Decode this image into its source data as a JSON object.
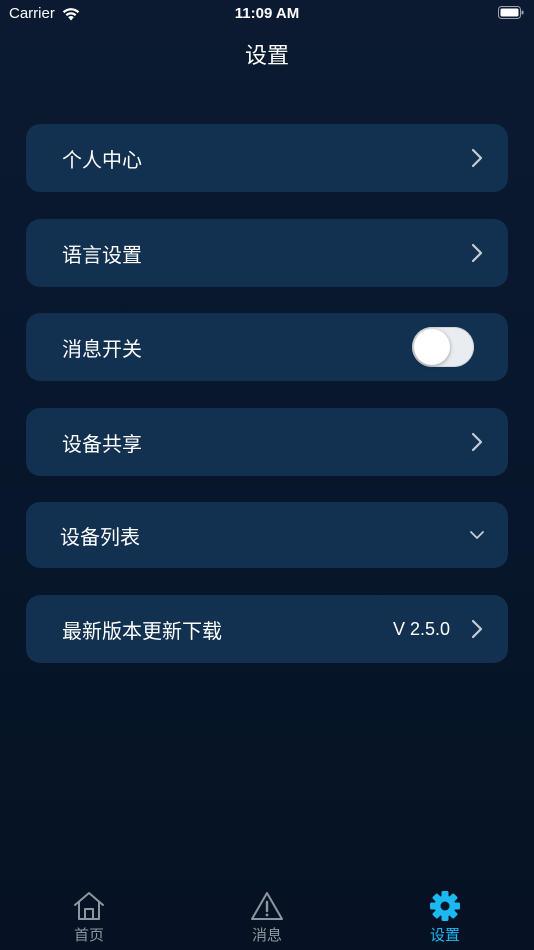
{
  "status_bar": {
    "carrier": "Carrier",
    "time": "11:09 AM"
  },
  "nav": {
    "title": "设置"
  },
  "menu": {
    "personal_center": "个人中心",
    "language_settings": "语言设置",
    "message_switch": "消息开关",
    "message_switch_on": false,
    "device_sharing": "设备共享",
    "device_list": "设备列表",
    "latest_version": "最新版本更新下载",
    "version_value": "V 2.5.0"
  },
  "tabs": {
    "home": "首页",
    "messages": "消息",
    "settings": "设置",
    "active": "settings"
  },
  "colors": {
    "background": "#0b1a30",
    "card": "#12304f",
    "active_tab": "#1cb8f0",
    "inactive_tab": "#8e96a0"
  }
}
